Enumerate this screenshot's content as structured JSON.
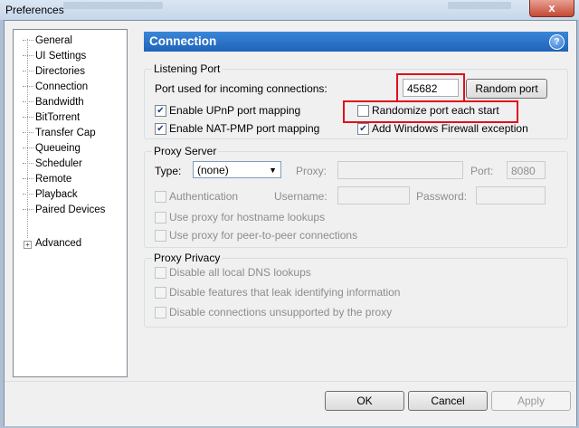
{
  "window": {
    "title": "Preferences",
    "close_glyph": "x"
  },
  "sidebar": {
    "items": [
      {
        "label": "General"
      },
      {
        "label": "UI Settings"
      },
      {
        "label": "Directories"
      },
      {
        "label": "Connection",
        "selected": true
      },
      {
        "label": "Bandwidth"
      },
      {
        "label": "BitTorrent"
      },
      {
        "label": "Transfer Cap"
      },
      {
        "label": "Queueing"
      },
      {
        "label": "Scheduler"
      },
      {
        "label": "Remote"
      },
      {
        "label": "Playback"
      },
      {
        "label": "Paired Devices"
      },
      {
        "label": "Advanced",
        "expandable": true
      }
    ]
  },
  "header": {
    "title": "Connection",
    "help_icon": "?"
  },
  "listening": {
    "group_title": "Listening Port",
    "port_label": "Port used for incoming connections:",
    "port_value": "45682",
    "random_port_button": "Random port",
    "upnp_label": "Enable UPnP port mapping",
    "upnp_checked": true,
    "randomize_label": "Randomize port each start",
    "randomize_checked": false,
    "natpmp_label": "Enable NAT-PMP port mapping",
    "natpmp_checked": true,
    "firewall_label": "Add Windows Firewall exception",
    "firewall_checked": true
  },
  "proxy": {
    "group_title": "Proxy Server",
    "type_label": "Type:",
    "type_value": "(none)",
    "proxy_label": "Proxy:",
    "port_label": "Port:",
    "port_value": "8080",
    "auth_label": "Authentication",
    "username_label": "Username:",
    "password_label": "Password:",
    "hostname_label": "Use proxy for hostname lookups",
    "p2p_label": "Use proxy for peer-to-peer connections"
  },
  "privacy": {
    "group_title": "Proxy Privacy",
    "dns_label": "Disable all local DNS lookups",
    "leak_label": "Disable features that leak identifying information",
    "unsupported_label": "Disable connections unsupported by the proxy"
  },
  "footer": {
    "ok": "OK",
    "cancel": "Cancel",
    "apply": "Apply"
  },
  "colors": {
    "accent": "#2a72cc",
    "highlight_box": "#e0101d"
  }
}
